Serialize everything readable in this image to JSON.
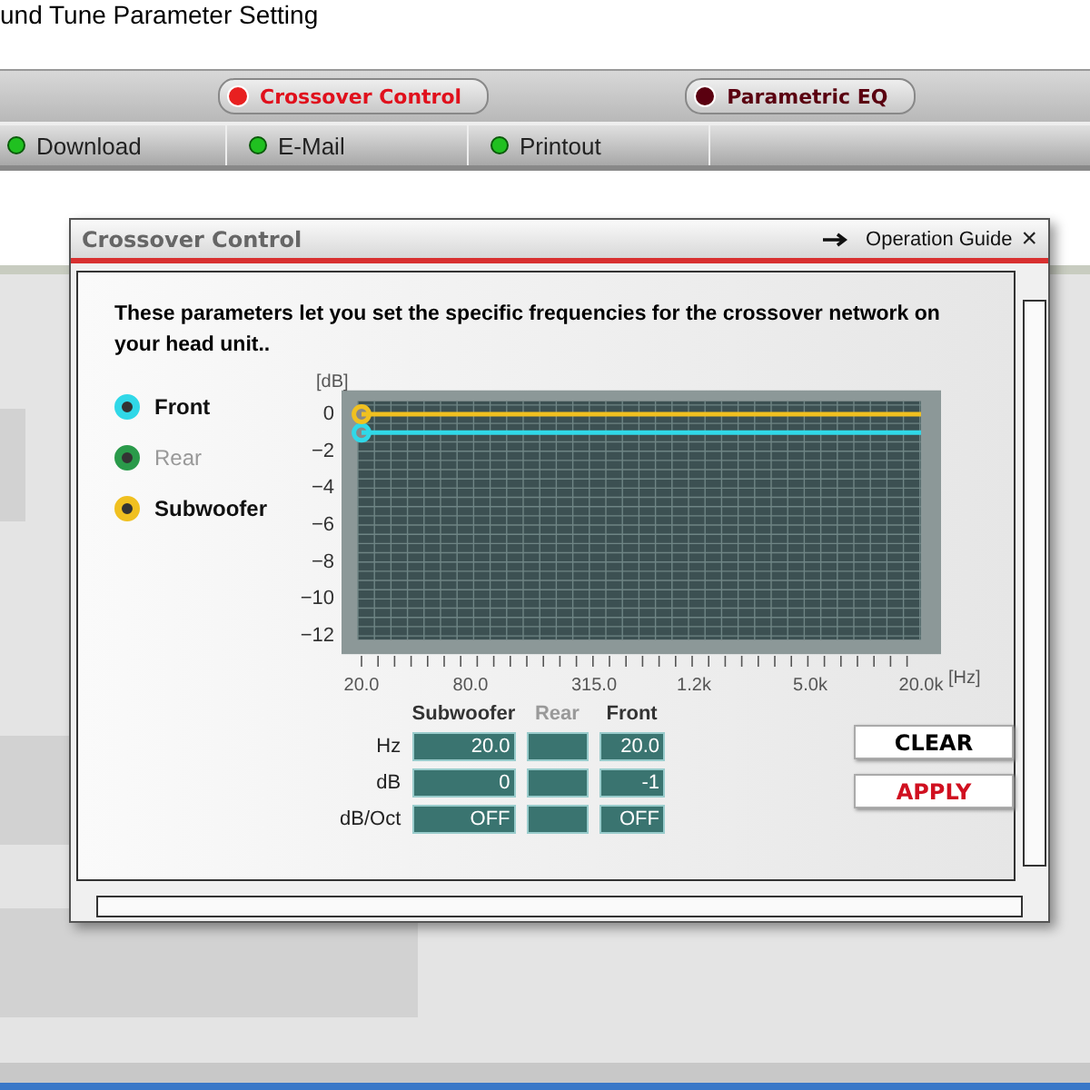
{
  "page_title": "und Tune Parameter Setting",
  "tabs": [
    {
      "label": "Crossover Control",
      "selected": true
    },
    {
      "label": "Parametric EQ",
      "selected": false
    }
  ],
  "links": [
    {
      "label": "Download"
    },
    {
      "label": "E-Mail"
    },
    {
      "label": "Printout"
    }
  ],
  "dialog": {
    "title": "Crossover Control",
    "guide": "Operation Guide",
    "close": "×",
    "description": "These parameters let you set the specific frequencies for the crossover network on your head unit..",
    "chart_data": {
      "type": "line",
      "xlabel": "[Hz]",
      "ylabel": "[dB]",
      "categories": [
        "20.0",
        "80.0",
        "315.0",
        "1.2k",
        "5.0k",
        "20.0k"
      ],
      "grid": true,
      "ylim": [
        -12.2,
        0.7
      ],
      "yticks": [
        {
          "value": 0,
          "label": "0"
        },
        {
          "value": -2,
          "label": "−2"
        },
        {
          "value": -4,
          "label": "−4"
        },
        {
          "value": -6,
          "label": "−6"
        },
        {
          "value": -8,
          "label": "−8"
        },
        {
          "value": -10,
          "label": "−10"
        },
        {
          "value": -12,
          "label": "−12"
        }
      ],
      "series": [
        {
          "name": "Front",
          "color": "#30d8e8",
          "values": [
            -1,
            -1,
            -1,
            -1,
            -1,
            -1
          ]
        },
        {
          "name": "Rear",
          "color": "#2a9a4a",
          "values": [
            null,
            null,
            null,
            null,
            null,
            null
          ]
        },
        {
          "name": "Subwoofer",
          "color": "#f0c020",
          "values": [
            0,
            0,
            0,
            0,
            0,
            0
          ]
        }
      ]
    },
    "table": {
      "columns": [
        {
          "label": "Subwoofer",
          "disabled": false
        },
        {
          "label": "Rear",
          "disabled": true
        },
        {
          "label": "Front",
          "disabled": false
        }
      ],
      "rows": [
        {
          "label": "Hz",
          "cells": [
            "20.0",
            "",
            "20.0"
          ]
        },
        {
          "label": "dB",
          "cells": [
            "0",
            "",
            "-1"
          ]
        },
        {
          "label": "dB/Oct",
          "cells": [
            "OFF",
            "",
            "OFF"
          ]
        }
      ]
    },
    "buttons": [
      {
        "label": "CLEAR",
        "color": "#000000"
      },
      {
        "label": "APPLY",
        "color": "#d01020"
      }
    ]
  }
}
